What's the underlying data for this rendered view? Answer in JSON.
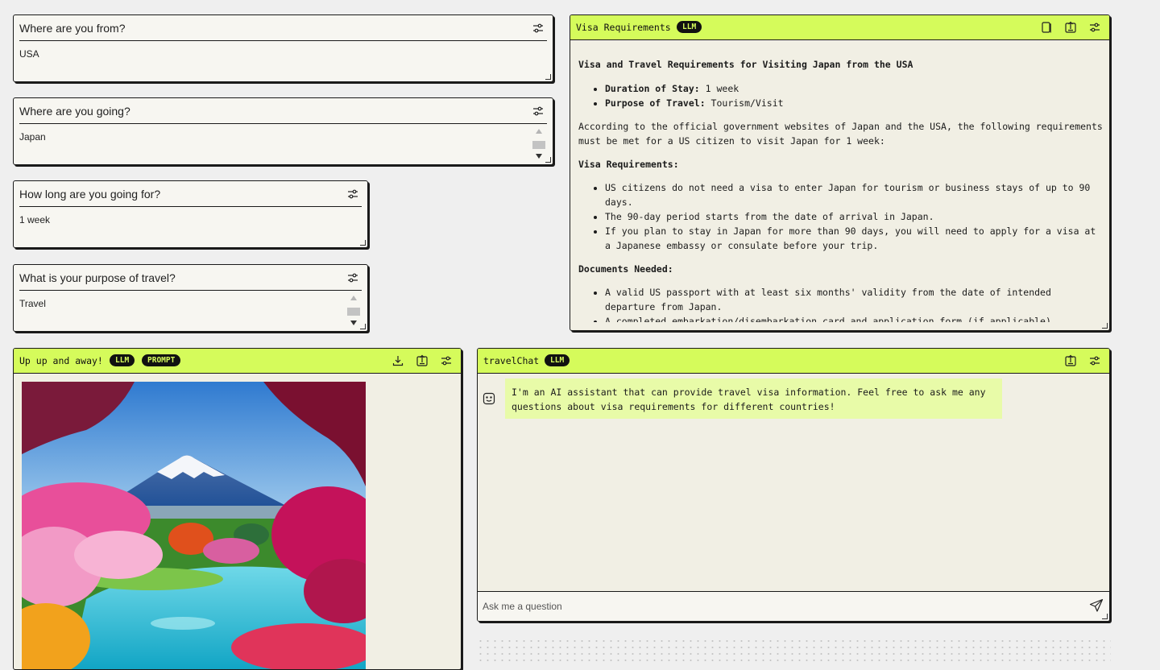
{
  "inputs": [
    {
      "question": "Where are you from?",
      "value": "USA"
    },
    {
      "question": "Where are you going?",
      "value": "Japan"
    },
    {
      "question": "How long are you going for?",
      "value": "1 week"
    },
    {
      "question": "What is your purpose of travel?",
      "value": "Travel"
    }
  ],
  "visa_panel": {
    "title": "Visa Requirements",
    "badge": "LLM",
    "heading": "Visa and Travel Requirements for Visiting Japan from the USA",
    "summary": [
      {
        "label": "Duration of Stay:",
        "value": " 1 week"
      },
      {
        "label": "Purpose of Travel:",
        "value": " Tourism/Visit"
      }
    ],
    "intro": "According to the official government websites of Japan and the USA, the following requirements must be met for a US citizen to visit Japan for 1 week:",
    "visa_heading": "Visa Requirements:",
    "visa_items": [
      "US citizens do not need a visa to enter Japan for tourism or business stays of up to 90 days.",
      "The 90-day period starts from the date of arrival in Japan.",
      "If you plan to stay in Japan for more than 90 days, you will need to apply for a visa at a Japanese embassy or consulate before your trip."
    ],
    "docs_heading": "Documents Needed:",
    "docs_items": [
      "A valid US passport with at least six months' validity from the date of intended departure from Japan.",
      "A completed embarkation/disembarkation card and application form (if applicable)."
    ],
    "icons": [
      "copy-icon",
      "export-icon",
      "settings-sliders-icon"
    ]
  },
  "image_panel": {
    "title": "Up up and away!",
    "badges": [
      "LLM",
      "PROMPT"
    ],
    "icons": [
      "download-icon",
      "export-icon",
      "settings-sliders-icon"
    ],
    "image_subject": "Mount Fuji with cherry blossoms and turquoise lake"
  },
  "chat_panel": {
    "title": "travelChat",
    "badge": "LLM",
    "assistant_message": "I'm an AI assistant that can provide travel visa information. Feel free to ask me any questions about visa requirements for different countries!",
    "input_placeholder": "Ask me a question",
    "icons": [
      "export-icon",
      "settings-sliders-icon",
      "send-icon",
      "bot-face-icon"
    ]
  },
  "colors": {
    "accent": "#d5fb5b",
    "bubble": "#e8fba8",
    "panel_bg": "#f1efe4",
    "card_bg": "#f7f6f1"
  }
}
